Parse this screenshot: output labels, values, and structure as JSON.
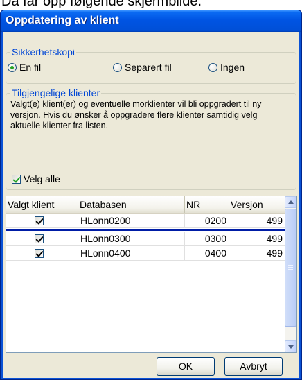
{
  "page": {
    "caption": "Da får opp følgende skjermbilde."
  },
  "dialog": {
    "title": "Oppdatering av klient"
  },
  "backup": {
    "legend": "Sikkerhetskopi",
    "options": [
      {
        "label": "En fil",
        "checked": true
      },
      {
        "label": "Separert fil",
        "checked": false
      },
      {
        "label": "Ingen",
        "checked": false
      }
    ]
  },
  "clients": {
    "legend": "Tilgjengelige klienter",
    "description": "Valgt(e) klient(er) og eventuelle morklienter vil bli oppgradert til ny versjon. Hvis du ønsker å oppgradere flere klienter samtidig velg aktuelle klienter fra listen.",
    "select_all": {
      "label": "Velg alle",
      "checked": true
    },
    "table": {
      "columns": [
        "Valgt klient",
        "Databasen",
        "NR",
        "Versjon"
      ],
      "rows": [
        {
          "selected": true,
          "database": "HLonn0200",
          "nr": "0200",
          "version": "499"
        },
        {
          "selected": true,
          "database": "HLonn0300",
          "nr": "0300",
          "version": "499"
        },
        {
          "selected": true,
          "database": "HLonn0400",
          "nr": "0400",
          "version": "499"
        }
      ]
    }
  },
  "buttons": {
    "ok": "OK",
    "cancel": "Avbryt"
  },
  "colors": {
    "titlebar": "#0054e3",
    "group_title": "#0046d5",
    "dialog_bg": "#ece9d8",
    "radio_dot": "#21a121"
  }
}
